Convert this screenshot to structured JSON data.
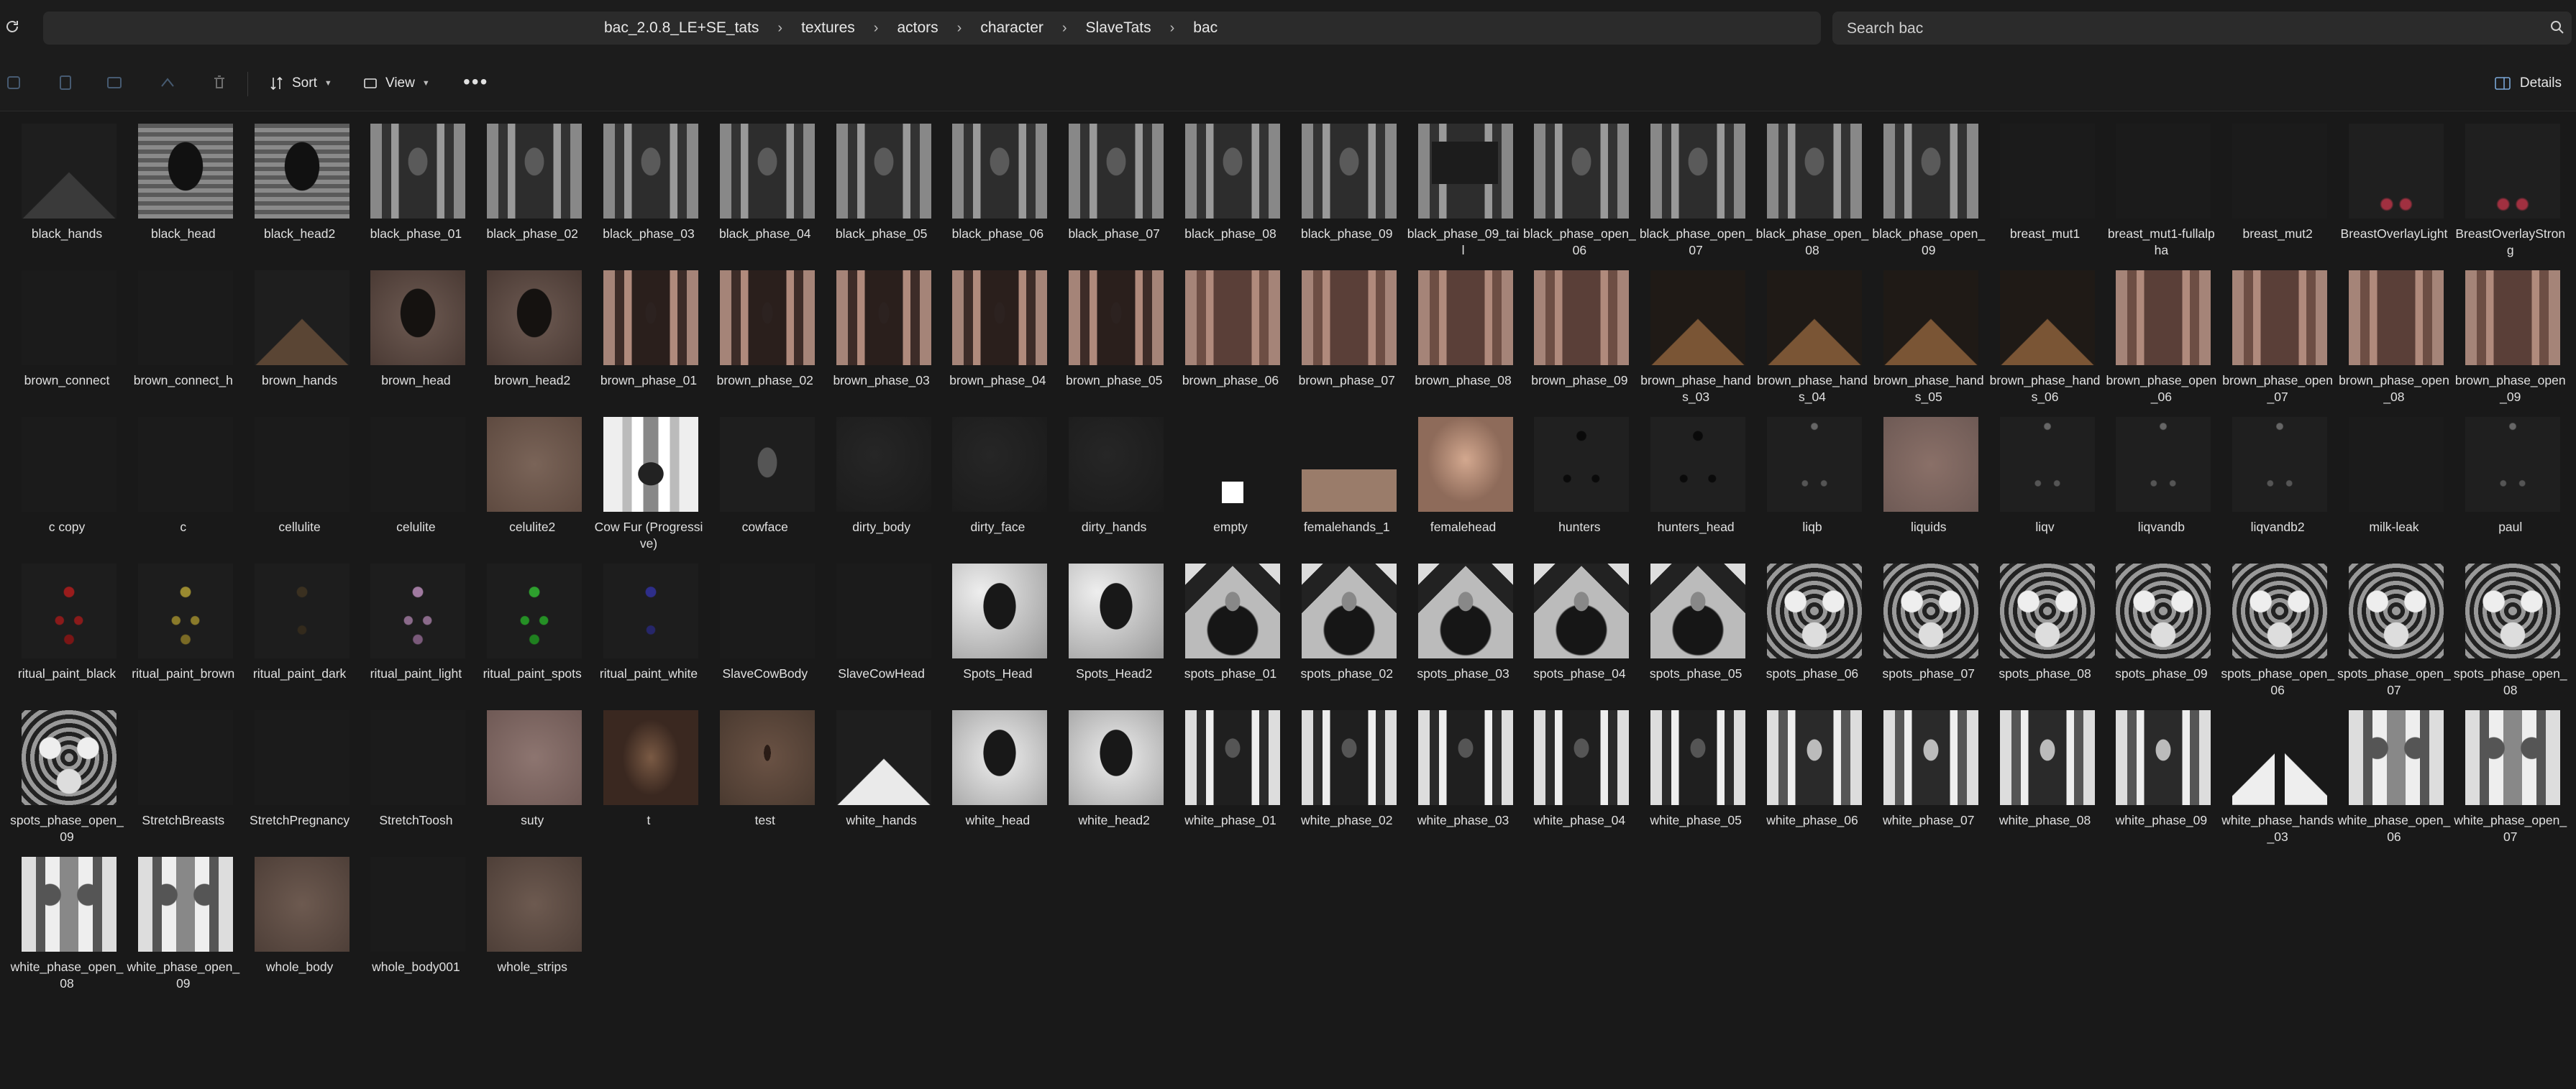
{
  "address": {
    "crumbs": [
      "bac_2.0.8_LE+SE_tats",
      "textures",
      "actors",
      "character",
      "SlaveTats",
      "bac"
    ],
    "separator": "›"
  },
  "search": {
    "placeholder": "Search bac"
  },
  "toolbar": {
    "sort_label": "Sort",
    "view_label": "View",
    "more_label": "•••",
    "details_label": "Details"
  },
  "colors": {
    "background": "#191919",
    "bar": "#2b2b2b",
    "text": "#e0e0e0"
  },
  "files": [
    {
      "name": "black_hands",
      "style": "t-hands"
    },
    {
      "name": "black_head",
      "style": "t-blackhead"
    },
    {
      "name": "black_head2",
      "style": "t-blackhead"
    },
    {
      "name": "black_phase_01",
      "style": "t-blackphase"
    },
    {
      "name": "black_phase_02",
      "style": "t-blackphase"
    },
    {
      "name": "black_phase_03",
      "style": "t-blackphase"
    },
    {
      "name": "black_phase_04",
      "style": "t-blackphase"
    },
    {
      "name": "black_phase_05",
      "style": "t-blackphase"
    },
    {
      "name": "black_phase_06",
      "style": "t-blackphase"
    },
    {
      "name": "black_phase_07",
      "style": "t-blackphase"
    },
    {
      "name": "black_phase_08",
      "style": "t-blackphase"
    },
    {
      "name": "black_phase_09",
      "style": "t-blackphase"
    },
    {
      "name": "black_phase_09_tail",
      "style": "t-blackphase09"
    },
    {
      "name": "black_phase_open_06",
      "style": "t-blackphase"
    },
    {
      "name": "black_phase_open_07",
      "style": "t-blackphase"
    },
    {
      "name": "black_phase_open_08",
      "style": "t-blackphase"
    },
    {
      "name": "black_phase_open_09",
      "style": "t-blackphase"
    },
    {
      "name": "breast_mut1",
      "style": "t-darker"
    },
    {
      "name": "breast_mut1-fullalpha",
      "style": "t-darker"
    },
    {
      "name": "breast_mut2",
      "style": "t-darker"
    },
    {
      "name": "BreastOverlayLight",
      "style": "t-pinkdots"
    },
    {
      "name": "BreastOverlayStrong",
      "style": "t-pinkdots"
    },
    {
      "name": "brown_connect",
      "style": "t-darker"
    },
    {
      "name": "brown_connect_h",
      "style": "t-darker"
    },
    {
      "name": "brown_hands",
      "style": "t-brownhands"
    },
    {
      "name": "brown_head",
      "style": "t-brownhead"
    },
    {
      "name": "brown_head2",
      "style": "t-brownhead"
    },
    {
      "name": "brown_phase_01",
      "style": "t-brownphase"
    },
    {
      "name": "brown_phase_02",
      "style": "t-brownphase"
    },
    {
      "name": "brown_phase_03",
      "style": "t-brownphase"
    },
    {
      "name": "brown_phase_04",
      "style": "t-brownphase"
    },
    {
      "name": "brown_phase_05",
      "style": "t-brownphase"
    },
    {
      "name": "brown_phase_06",
      "style": "t-brownphase-b"
    },
    {
      "name": "brown_phase_07",
      "style": "t-brownphase-b"
    },
    {
      "name": "brown_phase_08",
      "style": "t-brownphase-b"
    },
    {
      "name": "brown_phase_09",
      "style": "t-brownphase-b"
    },
    {
      "name": "brown_phase_hands_03",
      "style": "t-brownhands-b"
    },
    {
      "name": "brown_phase_hands_04",
      "style": "t-brownhands-b"
    },
    {
      "name": "brown_phase_hands_05",
      "style": "t-brownhands-b"
    },
    {
      "name": "brown_phase_hands_06",
      "style": "t-brownhands-b"
    },
    {
      "name": "brown_phase_open_06",
      "style": "t-brownphase-b"
    },
    {
      "name": "brown_phase_open_07",
      "style": "t-brownphase-b"
    },
    {
      "name": "brown_phase_open_08",
      "style": "t-brownphase-b"
    },
    {
      "name": "brown_phase_open_09",
      "style": "t-brownphase-b"
    },
    {
      "name": "c copy",
      "style": "t-darker"
    },
    {
      "name": "c",
      "style": "t-darker"
    },
    {
      "name": "cellulite",
      "style": "t-darker"
    },
    {
      "name": "celulite",
      "style": "t-darker"
    },
    {
      "name": "celulite2",
      "style": "t-skin"
    },
    {
      "name": "Cow Fur (Progressive)",
      "style": "t-cowfur"
    },
    {
      "name": "cowface",
      "style": "t-cowface"
    },
    {
      "name": "dirty_body",
      "style": "t-dirty"
    },
    {
      "name": "dirty_face",
      "style": "t-dirty"
    },
    {
      "name": "dirty_hands",
      "style": "t-dirty"
    },
    {
      "name": "empty",
      "style": "t-empty"
    },
    {
      "name": "femalehands_1",
      "style": "t-femhands"
    },
    {
      "name": "femalehead",
      "style": "t-femhead"
    },
    {
      "name": "hunters",
      "style": "t-hunters"
    },
    {
      "name": "hunters_head",
      "style": "t-hunters"
    },
    {
      "name": "liqb",
      "style": "t-dots"
    },
    {
      "name": "liquids",
      "style": "t-liquids"
    },
    {
      "name": "liqv",
      "style": "t-dots"
    },
    {
      "name": "liqvandb",
      "style": "t-dots"
    },
    {
      "name": "liqvandb2",
      "style": "t-dots"
    },
    {
      "name": "milk-leak",
      "style": "t-darker"
    },
    {
      "name": "paul",
      "style": "t-dots"
    },
    {
      "name": "ritual_paint_black",
      "style": "t-ritual-red"
    },
    {
      "name": "ritual_paint_brown",
      "style": "t-ritual-brown"
    },
    {
      "name": "ritual_paint_dark",
      "style": "t-ritual-dark"
    },
    {
      "name": "ritual_paint_light",
      "style": "t-ritual-light"
    },
    {
      "name": "ritual_paint_spots",
      "style": "t-ritual-spots"
    },
    {
      "name": "ritual_paint_white",
      "style": "t-ritual-white"
    },
    {
      "name": "SlaveCowBody",
      "style": "t-darker"
    },
    {
      "name": "SlaveCowHead",
      "style": "t-darker"
    },
    {
      "name": "Spots_Head",
      "style": "t-spotshead"
    },
    {
      "name": "Spots_Head2",
      "style": "t-spotshead"
    },
    {
      "name": "spots_phase_01",
      "style": "t-spotsphase"
    },
    {
      "name": "spots_phase_02",
      "style": "t-spotsphase"
    },
    {
      "name": "spots_phase_03",
      "style": "t-spotsphase"
    },
    {
      "name": "spots_phase_04",
      "style": "t-spotsphase"
    },
    {
      "name": "spots_phase_05",
      "style": "t-spotsphase"
    },
    {
      "name": "spots_phase_06",
      "style": "t-spotsopen"
    },
    {
      "name": "spots_phase_07",
      "style": "t-spotsopen"
    },
    {
      "name": "spots_phase_08",
      "style": "t-spotsopen"
    },
    {
      "name": "spots_phase_09",
      "style": "t-spotsopen"
    },
    {
      "name": "spots_phase_open_06",
      "style": "t-spotsopen"
    },
    {
      "name": "spots_phase_open_07",
      "style": "t-spotsopen"
    },
    {
      "name": "spots_phase_open_08",
      "style": "t-spotsopen"
    },
    {
      "name": "spots_phase_open_09",
      "style": "t-spotsopen"
    },
    {
      "name": "StretchBreasts",
      "style": "t-darker"
    },
    {
      "name": "StretchPregnancy",
      "style": "t-darker"
    },
    {
      "name": "StretchToosh",
      "style": "t-darker"
    },
    {
      "name": "suty",
      "style": "t-suty"
    },
    {
      "name": "t",
      "style": "t-t"
    },
    {
      "name": "test",
      "style": "t-test"
    },
    {
      "name": "white_hands",
      "style": "t-whitehands"
    },
    {
      "name": "white_head",
      "style": "t-whitehead"
    },
    {
      "name": "white_head2",
      "style": "t-whitehead"
    },
    {
      "name": "white_phase_01",
      "style": "t-whitephase"
    },
    {
      "name": "white_phase_02",
      "style": "t-whitephase"
    },
    {
      "name": "white_phase_03",
      "style": "t-whitephase"
    },
    {
      "name": "white_phase_04",
      "style": "t-whitephase"
    },
    {
      "name": "white_phase_05",
      "style": "t-whitephase"
    },
    {
      "name": "white_phase_06",
      "style": "t-whitephase-b"
    },
    {
      "name": "white_phase_07",
      "style": "t-whitephase-b"
    },
    {
      "name": "white_phase_08",
      "style": "t-whitephase-b"
    },
    {
      "name": "white_phase_09",
      "style": "t-whitephase-b"
    },
    {
      "name": "white_phase_hands_03",
      "style": "t-whitehands03"
    },
    {
      "name": "white_phase_open_06",
      "style": "t-whiteopen"
    },
    {
      "name": "white_phase_open_07",
      "style": "t-whiteopen"
    },
    {
      "name": "white_phase_open_08",
      "style": "t-whiteopen"
    },
    {
      "name": "white_phase_open_09",
      "style": "t-whiteopen"
    },
    {
      "name": "whole_body",
      "style": "t-wholebody"
    },
    {
      "name": "whole_body001",
      "style": "t-darker"
    },
    {
      "name": "whole_strips",
      "style": "t-wholebody"
    }
  ]
}
